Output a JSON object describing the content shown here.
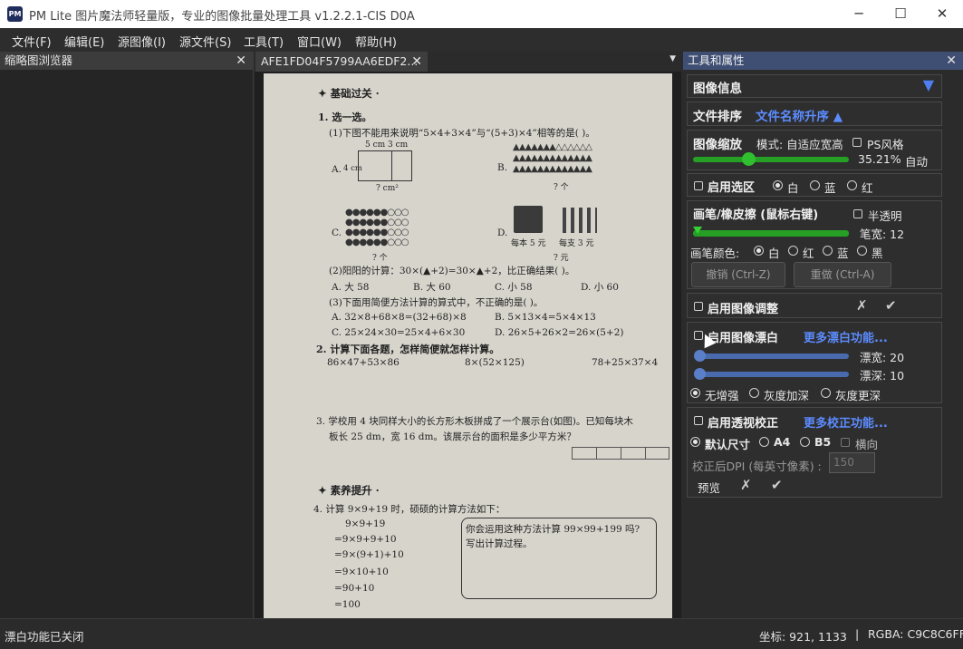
{
  "window": {
    "title": "PM Lite 图片魔法师轻量版，专业的图像批量处理工具 v1.2.2.1-CIS D0A",
    "icon_text": "PM",
    "minimize": "─",
    "maximize": "☐",
    "close": "✕"
  },
  "menu": [
    "文件(F)",
    "编辑(E)",
    "源图像(I)",
    "源文件(S)",
    "工具(T)",
    "窗口(W)",
    "帮助(H)"
  ],
  "left_panel": {
    "title": "缩略图浏览器",
    "close": "✕"
  },
  "document_tab": {
    "label": "AFE1FD04F5799AA6EDF2...",
    "close": "✕",
    "dropdown": "▼"
  },
  "document": {
    "section1": "✦ 基础过关 ·",
    "q1": "1. 选一选。",
    "q1_1": "(1)下图不能用来说明“5×4+3×4”与“(5+3)×4”相等的是(     )。",
    "q1_a": "A.",
    "q1_a_dims": "5 cm   3 cm",
    "q1_a_side": "4 cm",
    "q1_a_unit": "? cm²",
    "q1_b": "B.",
    "q1_b_unit": "? 个",
    "q1_c": "C.",
    "q1_c_unit": "? 个",
    "q1_d": "D.",
    "q1_d_price1": "每本 5 元",
    "q1_d_price2": "每支 3 元",
    "q1_d_unit": "? 元",
    "q1_2": "(2)阳阳的计算：30×(▲+2)=30×▲+2，比正确结果(     )。",
    "q1_2_opts": [
      "A. 大 58",
      "B. 大 60",
      "C. 小 58",
      "D. 小 60"
    ],
    "q1_3": "(3)下面用简便方法计算的算式中，不正确的是(     )。",
    "q1_3_opts": [
      "A. 32×8+68×8=(32+68)×8",
      "B. 5×13×4=5×4×13",
      "C. 25×24×30=25×4+6×30",
      "D. 26×5+26×2=26×(5+2)"
    ],
    "q2": "2. 计算下面各题，怎样简便就怎样计算。",
    "q2_exprs": [
      "86×47+53×86",
      "8×(52×125)",
      "78+25×37×4"
    ],
    "q3": "3. 学校用 4 块同样大小的长方形木板拼成了一个展示台(如图)。已知每块木",
    "q3_line2": "板长 25 dm，宽 16 dm。该展示台的面积是多少平方米？",
    "section2": "✦ 素养提升 ·",
    "q4": "4. 计算 9×9+19 时，硕硕的计算方法如下：",
    "q4_steps": [
      "9×9+19",
      "=9×9+9+10",
      "=9×(9+1)+10",
      "=9×10+10",
      "=90+10",
      "=100"
    ],
    "q4_box": [
      "你会运用这种方法计算 99×99+199 吗?",
      "写出计算过程。"
    ]
  },
  "right_panel": {
    "title": "工具和属性",
    "close": "✕",
    "image_info": {
      "label": "图像信息",
      "arrow": "▼"
    },
    "sort": {
      "label": "文件排序",
      "value": "文件名称升序 ▲"
    },
    "zoom": {
      "label": "图像缩放",
      "mode": "模式: 自适应宽高",
      "ps_style": "PS风格",
      "percent": "35.21%",
      "auto": "自动",
      "level": 0.3521
    },
    "selection": {
      "enable": "启用选区",
      "options": [
        "白",
        "蓝",
        "红"
      ],
      "selected": "白"
    },
    "brush": {
      "label": "画笔/橡皮擦 (鼠标右键)",
      "semi": "半透明",
      "width_label": "笔宽: 12",
      "color_label": "画笔颜色:",
      "colors": [
        "白",
        "红",
        "蓝",
        "黑"
      ],
      "selected": "白",
      "undo": "撤销 (Ctrl-Z)",
      "redo": "重做 (Ctrl-A)"
    },
    "adjust": {
      "label": "启用图像调整",
      "cancel": "✗",
      "ok": "✔"
    },
    "whiten": {
      "label": "启用图像漂白",
      "more": "更多漂白功能...",
      "width_label": "漂宽: 20",
      "depth_label": "漂深: 10",
      "options": [
        "无增强",
        "灰度加深",
        "灰度更深"
      ],
      "selected": "无增强"
    },
    "perspective": {
      "label": "启用透视校正",
      "more": "更多校正功能...",
      "sizes": [
        "默认尺寸",
        "A4",
        "B5"
      ],
      "selected": "默认尺寸",
      "landscape": "横向",
      "dpi_label": "校正后DPI (每英寸像素) :",
      "dpi_value": "150",
      "preview": "预览",
      "cancel": "✗",
      "ok": "✔"
    }
  },
  "status": {
    "left": "漂白功能已关闭",
    "coords": "坐标: 921, 1133",
    "sep": "|",
    "rgba": "RGBA: C9C8C6FF"
  },
  "colors": {
    "accent": "#5c8cff",
    "slider_green": "#25a025",
    "slider_blue": "#4a6aae",
    "panel_header": "#3f4f74"
  }
}
